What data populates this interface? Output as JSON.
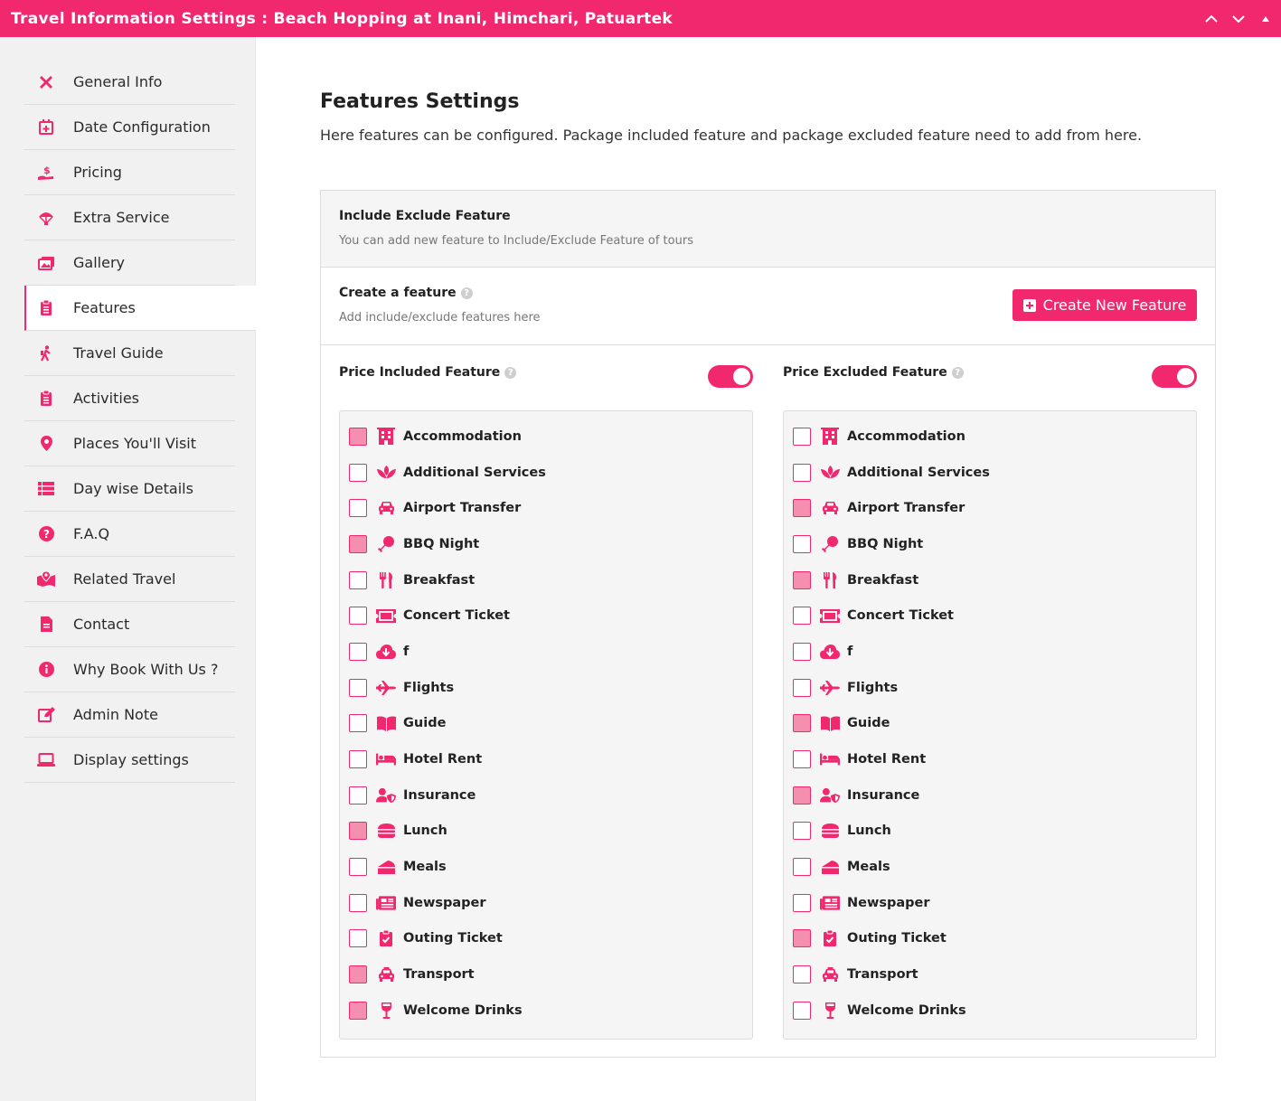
{
  "window": {
    "title": "Travel Information Settings : Beach Hopping at Inani, Himchari, Patuartek"
  },
  "colors": {
    "accent": "#f2286f",
    "checked": "#f58fb0"
  },
  "sidebar": {
    "items": [
      {
        "label": "General Info",
        "icon": "tools-icon"
      },
      {
        "label": "Date Configuration",
        "icon": "calendar-plus-icon"
      },
      {
        "label": "Pricing",
        "icon": "hand-dollar-icon"
      },
      {
        "label": "Extra Service",
        "icon": "parachute-icon"
      },
      {
        "label": "Gallery",
        "icon": "images-icon"
      },
      {
        "label": "Features",
        "icon": "clipboard-icon"
      },
      {
        "label": "Travel Guide",
        "icon": "hiking-icon"
      },
      {
        "label": "Activities",
        "icon": "clipboard-list-icon"
      },
      {
        "label": "Places You'll Visit",
        "icon": "map-marker-icon"
      },
      {
        "label": "Day wise Details",
        "icon": "list-icon"
      },
      {
        "label": "F.A.Q",
        "icon": "question-circle-icon"
      },
      {
        "label": "Related Travel",
        "icon": "map-location-icon"
      },
      {
        "label": "Contact",
        "icon": "file-icon"
      },
      {
        "label": "Why Book With Us ?",
        "icon": "info-circle-icon"
      },
      {
        "label": "Admin Note",
        "icon": "edit-icon"
      },
      {
        "label": "Display settings",
        "icon": "laptop-icon"
      }
    ]
  },
  "main": {
    "title": "Features Settings",
    "description": "Here features can be configured. Package included feature and package excluded feature need to add from here.",
    "card": {
      "title": "Include Exclude Feature",
      "subtitle": "You can add new feature to Include/Exclude Feature of tours"
    },
    "create": {
      "title": "Create a feature",
      "subtitle": "Add include/exclude features here",
      "button_label": "Create New Feature"
    },
    "included": {
      "title": "Price Included Feature",
      "checked": [
        true,
        false,
        false,
        true,
        false,
        false,
        false,
        false,
        false,
        false,
        false,
        true,
        false,
        false,
        false,
        true,
        true
      ]
    },
    "excluded": {
      "title": "Price Excluded Feature",
      "checked": [
        false,
        false,
        true,
        false,
        true,
        false,
        false,
        false,
        true,
        false,
        true,
        false,
        false,
        false,
        true,
        false,
        false
      ]
    },
    "features": [
      {
        "label": "Accommodation",
        "icon": "building-icon"
      },
      {
        "label": "Additional Services",
        "icon": "spa-icon"
      },
      {
        "label": "Airport Transfer",
        "icon": "car-icon"
      },
      {
        "label": "BBQ Night",
        "icon": "drumstick-icon"
      },
      {
        "label": "Breakfast",
        "icon": "utensils-icon"
      },
      {
        "label": "Concert Ticket",
        "icon": "ticket-icon"
      },
      {
        "label": "f",
        "icon": "cloud-download-icon"
      },
      {
        "label": "Flights",
        "icon": "plane-icon"
      },
      {
        "label": "Guide",
        "icon": "book-open-icon"
      },
      {
        "label": "Hotel Rent",
        "icon": "bed-icon"
      },
      {
        "label": "Insurance",
        "icon": "user-shield-icon"
      },
      {
        "label": "Lunch",
        "icon": "hamburger-icon"
      },
      {
        "label": "Meals",
        "icon": "cheese-icon"
      },
      {
        "label": "Newspaper",
        "icon": "newspaper-icon"
      },
      {
        "label": "Outing Ticket",
        "icon": "clipboard-check-icon"
      },
      {
        "label": "Transport",
        "icon": "taxi-icon"
      },
      {
        "label": "Welcome Drinks",
        "icon": "wine-glass-icon"
      }
    ]
  }
}
